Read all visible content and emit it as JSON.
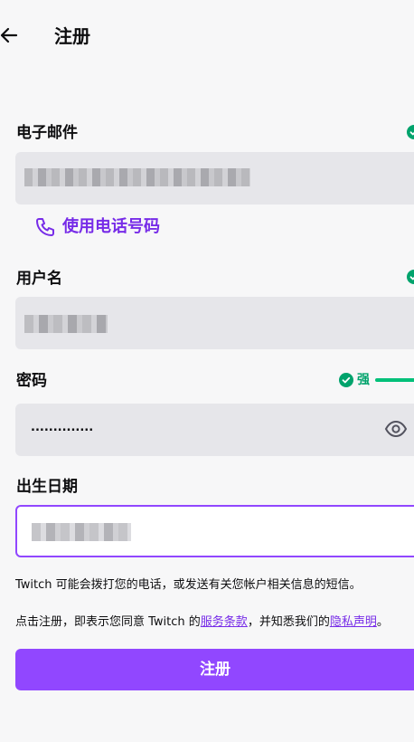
{
  "header": {
    "title": "注册"
  },
  "email": {
    "label": "电子邮件",
    "valid": true
  },
  "phone_link": {
    "label": "使用电话号码"
  },
  "username": {
    "label": "用户名",
    "valid": true
  },
  "password": {
    "label": "密码",
    "value": "..............",
    "strength": "强",
    "strength_level": 1.0
  },
  "birthdate": {
    "label": "出生日期"
  },
  "notices": {
    "sms": "Twitch 可能会拨打您的电话，或发送有关您帐户相关信息的短信。",
    "terms_prefix": "点击注册，即表示您同意 Twitch 的",
    "terms_link": "服务条款",
    "terms_middle": "，并知悉我们的",
    "privacy_link": "隐私声明",
    "terms_suffix": "。"
  },
  "submit": {
    "label": "注册"
  },
  "colors": {
    "accent": "#9147ff",
    "link": "#772ce8",
    "success": "#00a36c",
    "field_bg": "#e6e6ea"
  },
  "icons": [
    "arrow-left-icon",
    "check-circle-icon",
    "phone-icon",
    "eye-icon"
  ]
}
